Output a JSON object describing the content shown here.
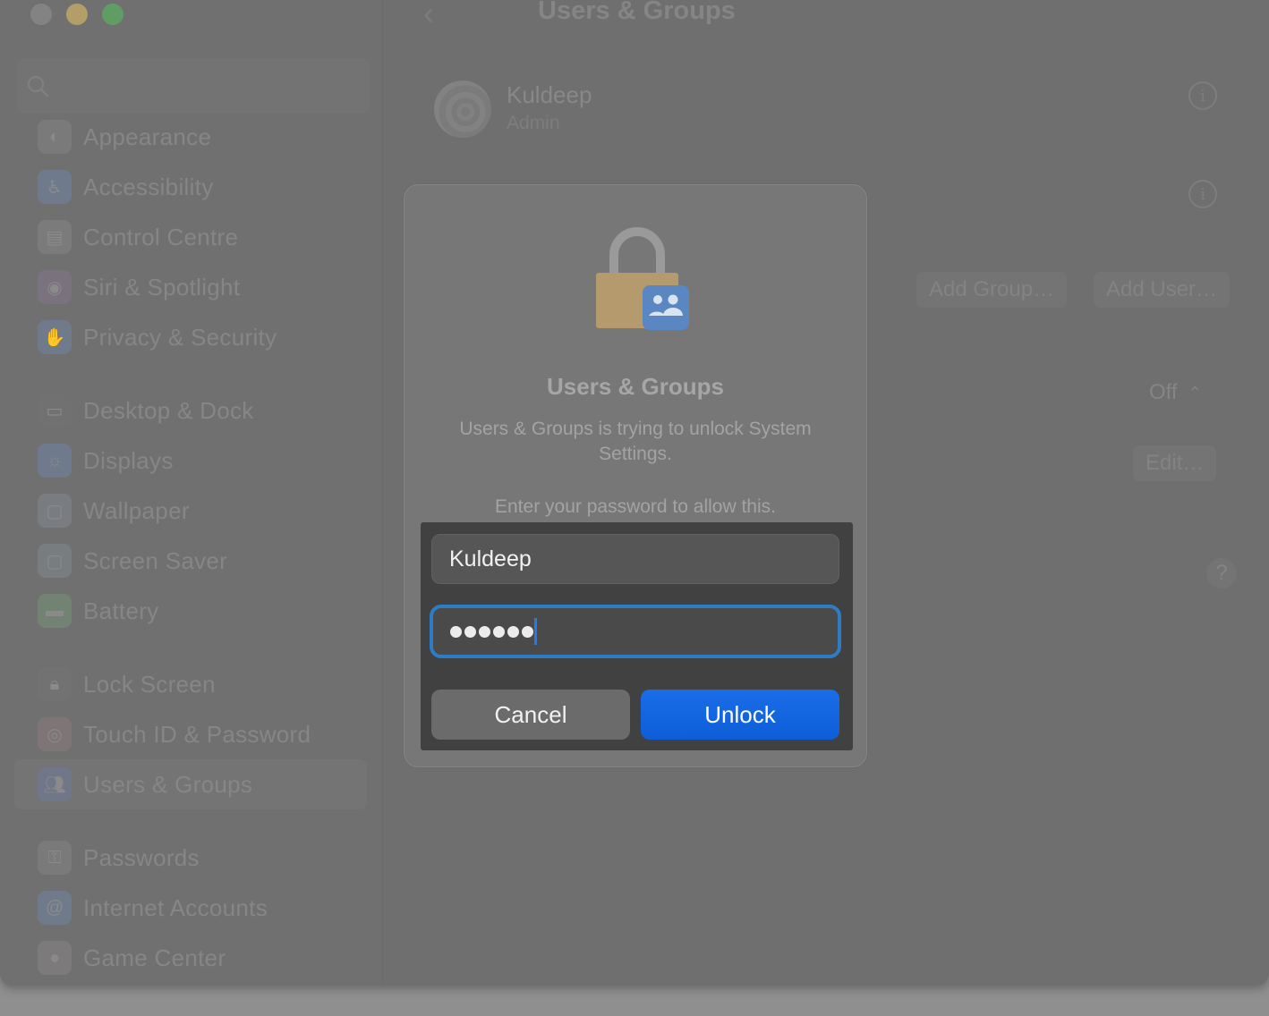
{
  "window": {
    "title": "Users & Groups",
    "traffic_lights": [
      "close",
      "minimize",
      "zoom"
    ]
  },
  "sidebar": {
    "search_placeholder": "Search",
    "groups": [
      {
        "items": [
          {
            "label": "Appearance",
            "icon": "appearance-icon",
            "color": "#7a7a7a"
          },
          {
            "label": "Accessibility",
            "icon": "accessibility-icon",
            "color": "#6f7b8c"
          },
          {
            "label": "Control Centre",
            "icon": "control-centre-icon",
            "color": "#7b7b7b"
          },
          {
            "label": "Siri & Spotlight",
            "icon": "siri-icon",
            "color": "#7a727d"
          },
          {
            "label": "Privacy & Security",
            "icon": "hand-icon",
            "color": "#6f7a8a"
          }
        ]
      },
      {
        "items": [
          {
            "label": "Desktop & Dock",
            "icon": "dock-icon",
            "color": "#717171"
          },
          {
            "label": "Displays",
            "icon": "displays-icon",
            "color": "#6f7a8c"
          },
          {
            "label": "Wallpaper",
            "icon": "wallpaper-icon",
            "color": "#797d82"
          },
          {
            "label": "Screen Saver",
            "icon": "screen-saver-icon",
            "color": "#787e80"
          },
          {
            "label": "Battery",
            "icon": "battery-icon",
            "color": "#728373"
          }
        ]
      },
      {
        "items": [
          {
            "label": "Lock Screen",
            "icon": "lock-screen-icon",
            "color": "#727272"
          },
          {
            "label": "Touch ID & Password",
            "icon": "fingerprint-icon",
            "color": "#7e7676"
          },
          {
            "label": "Users & Groups",
            "icon": "users-icon",
            "color": "#6f7789",
            "selected": true
          }
        ]
      },
      {
        "items": [
          {
            "label": "Passwords",
            "icon": "key-icon",
            "color": "#7a7a7a"
          },
          {
            "label": "Internet Accounts",
            "icon": "at-icon",
            "color": "#6f7a8a"
          },
          {
            "label": "Game Center",
            "icon": "game-center-icon",
            "color": "#7d7a7b"
          }
        ]
      }
    ]
  },
  "main": {
    "back_label": "‹",
    "title": "Users & Groups",
    "user": {
      "name": "Kuldeep",
      "role": "Admin"
    },
    "add_group_label": "Add Group…",
    "add_user_label": "Add User…",
    "auto_login_value": "Off",
    "edit_label": "Edit…",
    "help_label": "?"
  },
  "dialog": {
    "title": "Users & Groups",
    "message": "Users & Groups is trying to unlock System Settings.",
    "prompt": "Enter your password to allow this.",
    "username_value": "Kuldeep",
    "password_length": 6,
    "cancel_label": "Cancel",
    "unlock_label": "Unlock",
    "accent_color": "#1466e3",
    "focus_ring_color": "#2d7cc4"
  }
}
